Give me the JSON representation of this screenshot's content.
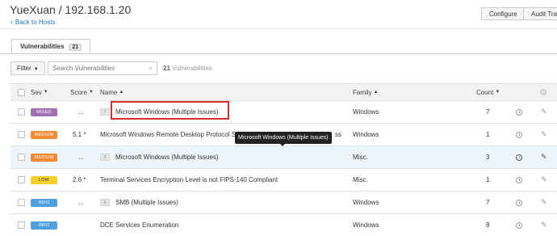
{
  "header": {
    "title": "YueXuan / 192.168.1.20",
    "back_link": "Back to Hosts",
    "configure_label": "Configure",
    "audit_label": "Audit Tra"
  },
  "tabs": {
    "vulnerabilities_label": "Vulnerabilities",
    "vulnerabilities_count": "21"
  },
  "filter": {
    "filter_label": "Filter",
    "search_placeholder": "Search Vulnerabilities",
    "count_number": "21",
    "count_label": "Vulnerabilities"
  },
  "table": {
    "columns": {
      "sev": "Sev",
      "score": "Score",
      "name": "Name",
      "family": "Family",
      "count": "Count"
    },
    "rows": [
      {
        "severity": "MIXED",
        "score": "...",
        "group_count": "7",
        "name": "Microsoft Windows (Multiple Issues)",
        "family": "Windows",
        "count": "7"
      },
      {
        "severity": "MEDIUM",
        "score": "5.1 *",
        "group_count": "",
        "name": "Microsoft Windows Remote Desktop Protocol S",
        "family": "Windows",
        "count": "1"
      },
      {
        "severity": "MEDIUM",
        "score": "...",
        "group_count": "3",
        "name": "Microsoft Windows (Multiple Issues)",
        "family": "Misc.",
        "count": "3"
      },
      {
        "severity": "LOW",
        "score": "2.6 *",
        "group_count": "",
        "name": "Terminal Services Encryption Level is not FIPS-140 Compliant",
        "family": "Misc.",
        "count": "1"
      },
      {
        "severity": "INFO",
        "score": "...",
        "group_count": "6",
        "name": "SMB (Multiple Issues)",
        "family": "Windows",
        "count": "7"
      },
      {
        "severity": "INFO",
        "score": "",
        "group_count": "",
        "name": "DCE Services Enumeration",
        "family": "Windows",
        "count": "8"
      }
    ]
  },
  "tooltip": {
    "text": "Microsoft Windows (Multiple Issues)",
    "trailing_text": "ss"
  },
  "colors": {
    "mixed": "#a26fb4",
    "medium": "#f38b35",
    "low": "#f7cf2c",
    "info": "#4ea0e0",
    "link": "#1f73b7",
    "highlight_box": "#d42d2d"
  }
}
